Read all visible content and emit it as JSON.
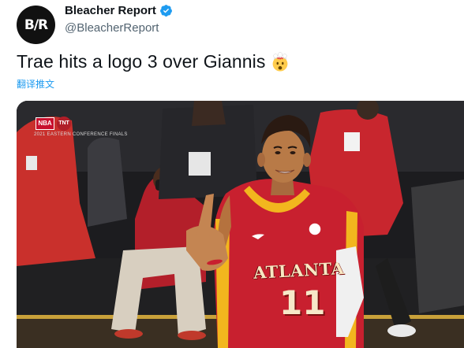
{
  "tweet": {
    "display_name": "Bleacher Report",
    "handle": "@BleacherReport",
    "avatar_text": "B/R",
    "verified": true,
    "text": "Trae hits a logo 3 over Giannis",
    "emoji": "exploding-head-emoji",
    "translate_label": "翻译推文"
  },
  "media": {
    "broadcast": {
      "nba_logo": "NBA",
      "tnt_logo": "TNT",
      "caption": "2021 EASTERN CONFERENCE FINALS"
    },
    "jersey": {
      "team": "ATLANTA",
      "number": "11"
    }
  },
  "colors": {
    "text_primary": "#0f1419",
    "text_secondary": "#536471",
    "link": "#1d9bf0",
    "verified": "#1d9bf0",
    "jersey_red": "#c8202f",
    "jersey_gold": "#f2b61e"
  }
}
